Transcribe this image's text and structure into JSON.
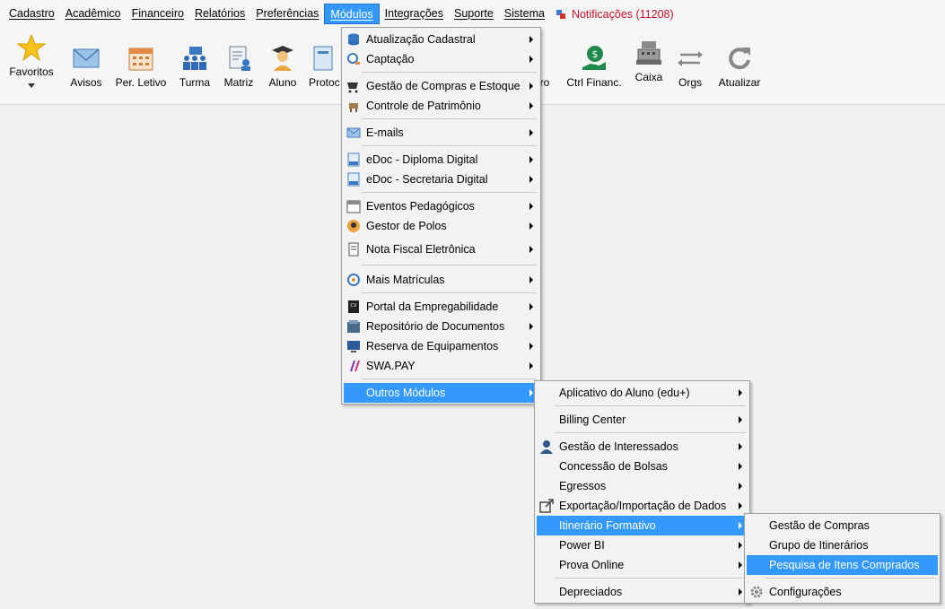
{
  "menubar": {
    "items": [
      "Cadastro",
      "Acadêmico",
      "Financeiro",
      "Relatórios",
      "Preferências",
      "Módulos",
      "Integrações",
      "Suporte",
      "Sistema"
    ],
    "active": "Módulos",
    "notifications": "Notificações (11208)"
  },
  "toolbar": {
    "favoritos": "Favoritos",
    "avisos": "Avisos",
    "per_letivo": "Per. Letivo",
    "turma": "Turma",
    "matriz": "Matriz",
    "aluno": "Aluno",
    "protocolo": "Protoc",
    "financeiro_partial": "iro",
    "ctrl_financ": "Ctrl Financ.",
    "caixa": "Caixa",
    "orgs": "Orgs",
    "atualizar": "Atualizar"
  },
  "modulos_menu": [
    "Atualização Cadastral",
    "Captação",
    "Gestão de Compras e Estoque",
    "Controle de Patrimônio",
    "E-mails",
    "eDoc - Diploma Digital",
    "eDoc - Secretaria Digital",
    "Eventos Pedagógicos",
    "Gestor de Polos",
    "Nota Fiscal Eletrônica",
    "Mais Matrículas",
    "Portal da Empregabilidade",
    "Repositório de Documentos",
    "Reserva de Equipamentos",
    "SWA.PAY",
    "Outros Módulos"
  ],
  "outros_menu": [
    "Aplicativo do Aluno (edu+)",
    "Billing Center",
    "Gestão de Interessados",
    "Concessão de Bolsas",
    "Egressos",
    "Exportação/Importação de Dados",
    "Itinerário Formativo",
    "Power BI",
    "Prova Online",
    "Depreciados"
  ],
  "itinerario_menu": [
    "Gestão de Compras",
    "Grupo de Itinerários",
    "Pesquisa de Itens Comprados",
    "Configurações"
  ],
  "colors": {
    "highlight": "#3399ff",
    "notification": "#c8102e"
  }
}
